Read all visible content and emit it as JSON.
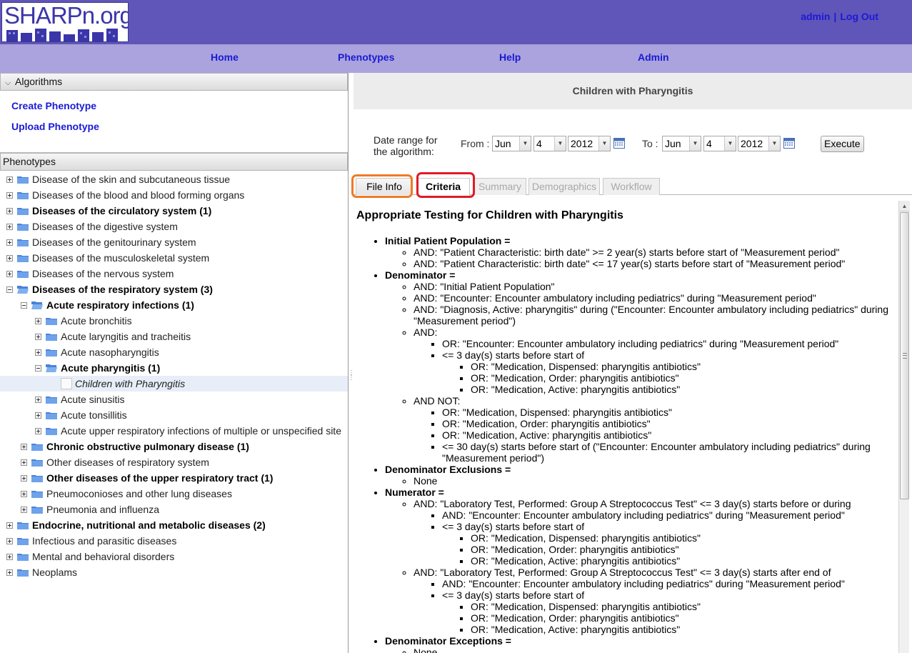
{
  "header": {
    "logo_text": "SHARPn.org",
    "user_link": "admin",
    "separator": "|",
    "logout_link": "Log Out"
  },
  "nav": {
    "items": [
      {
        "label": "Home"
      },
      {
        "label": "Phenotypes"
      },
      {
        "label": "Help"
      },
      {
        "label": "Admin"
      }
    ]
  },
  "sidebar": {
    "algorithms_title": "Algorithms",
    "create_phenotype": "Create Phenotype",
    "upload_phenotype": "Upload Phenotype",
    "phenotypes_title": "Phenotypes",
    "tree": [
      {
        "label": "Disease of the skin and subcutaneous tissue",
        "bold": false
      },
      {
        "label": "Diseases of the blood and blood forming organs",
        "bold": false
      },
      {
        "label": "Diseases of the circulatory system (1)",
        "bold": true
      },
      {
        "label": "Diseases of the digestive system",
        "bold": false
      },
      {
        "label": "Diseases of the genitourinary system",
        "bold": false
      },
      {
        "label": "Diseases of the musculoskeletal system",
        "bold": false
      },
      {
        "label": "Diseases of the nervous system",
        "bold": false
      },
      {
        "label": "Diseases of the respiratory system (3)",
        "bold": true
      },
      {
        "label": "Acute respiratory infections (1)",
        "bold": true
      },
      {
        "label": "Acute bronchitis",
        "bold": false
      },
      {
        "label": "Acute laryngitis and tracheitis",
        "bold": false
      },
      {
        "label": "Acute nasopharyngitis",
        "bold": false
      },
      {
        "label": "Acute pharyngitis (1)",
        "bold": true
      },
      {
        "label": "Children with Pharyngitis",
        "bold": false
      },
      {
        "label": "Acute sinusitis",
        "bold": false
      },
      {
        "label": "Acute tonsillitis",
        "bold": false
      },
      {
        "label": "Acute upper respiratory infections of multiple or unspecified site",
        "bold": false
      },
      {
        "label": "Chronic obstructive pulmonary disease (1)",
        "bold": true
      },
      {
        "label": "Other diseases of respiratory system",
        "bold": false
      },
      {
        "label": "Other diseases of the upper respiratory tract (1)",
        "bold": true
      },
      {
        "label": "Pneumoconioses and other lung diseases",
        "bold": false
      },
      {
        "label": "Pneumonia and influenza",
        "bold": false
      },
      {
        "label": "Endocrine, nutritional and metabolic diseases (2)",
        "bold": true
      },
      {
        "label": "Infectious and parasitic diseases",
        "bold": false
      },
      {
        "label": "Mental and behavioral disorders",
        "bold": false
      },
      {
        "label": "Neoplams",
        "bold": false
      }
    ]
  },
  "main": {
    "title": "Children with Pharyngitis",
    "date_range_label_1": "Date range for",
    "date_range_label_2": "the algorithm:",
    "from_label": "From :",
    "to_label": "To :",
    "from_month": "Jun",
    "from_day": "4",
    "from_year": "2012",
    "to_month": "Jun",
    "to_day": "4",
    "to_year": "2012",
    "execute_label": "Execute",
    "tabs": [
      "File Info",
      "Criteria",
      "Summary",
      "Demographics",
      "Workflow"
    ],
    "active_tab": "Criteria",
    "heading": "Appropriate Testing for Children with Pharyngitis",
    "ipp_title": "Initial Patient Population =",
    "ipp_1": "AND: \"Patient Characteristic: birth date\" >= 2 year(s) starts before start of \"Measurement period\"",
    "ipp_2": "AND: \"Patient Characteristic: birth date\" <= 17 year(s) starts before start of \"Measurement period\"",
    "den_title": "Denominator =",
    "den_1": "AND: \"Initial Patient Population\"",
    "den_2": "AND: \"Encounter: Encounter ambulatory including pediatrics\" during \"Measurement period\"",
    "den_3": "AND: \"Diagnosis, Active: pharyngitis\" during (\"Encounter: Encounter ambulatory including pediatrics\" during \"Measurement period\")",
    "den_4": "AND:",
    "den_4a": "OR: \"Encounter: Encounter ambulatory including pediatrics\" during \"Measurement period\"",
    "den_4b": "<= 3 day(s) starts before start of",
    "med_dispensed": "OR: \"Medication, Dispensed: pharyngitis antibiotics\"",
    "med_order": "OR: \"Medication, Order: pharyngitis antibiotics\"",
    "med_active": "OR: \"Medication, Active: pharyngitis antibiotics\"",
    "den_5": "AND NOT:",
    "den_5d": "<= 30 day(s) starts before start of (\"Encounter: Encounter ambulatory including pediatrics\" during \"Measurement period\")",
    "excl_title": "Denominator Exclusions =",
    "none": "None",
    "num_title": "Numerator =",
    "num_1": "AND: \"Laboratory Test, Performed: Group A Streptococcus Test\" <= 3 day(s) starts before or during",
    "num_enc": "AND: \"Encounter: Encounter ambulatory including pediatrics\" during \"Measurement period\"",
    "num_3day": "<= 3 day(s) starts before start of",
    "num_2": "AND: \"Laboratory Test, Performed: Group A Streptococcus Test\" <= 3 day(s) starts after end of",
    "exc_title": "Denominator Exceptions ="
  },
  "colors": {
    "header_bg": "#6055b8",
    "nav_bg": "#aaa3dd",
    "link": "#1a1ad6",
    "highlight_orange": "#f07a25",
    "highlight_red": "#e01b24"
  }
}
